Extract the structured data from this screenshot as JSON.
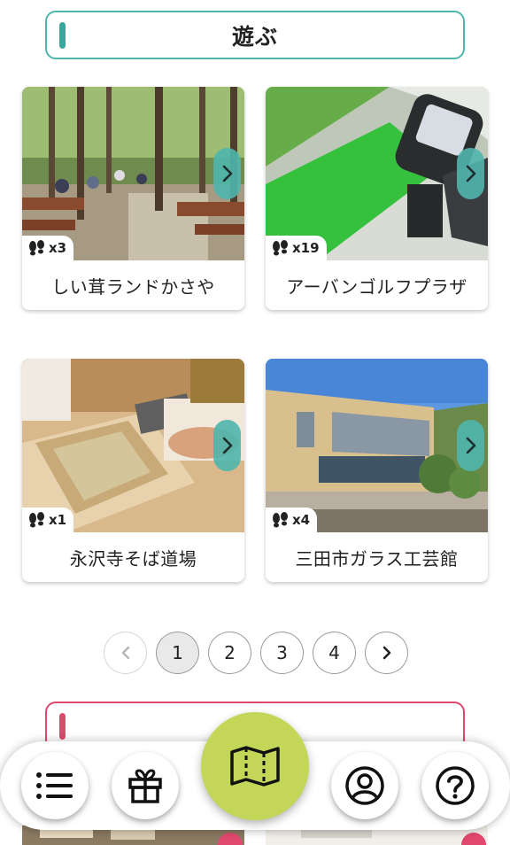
{
  "section": {
    "title": "遊ぶ"
  },
  "cards": [
    {
      "name": "しい茸ランドかさや",
      "visit_count": "x3"
    },
    {
      "name": "アーバンゴルフプラザ",
      "visit_count": "x19"
    },
    {
      "name": "永沢寺そば道場",
      "visit_count": "x1"
    },
    {
      "name": "三田市ガラス工芸館",
      "visit_count": "x4"
    }
  ],
  "pagination": {
    "prev_icon": "chevron-left-icon",
    "next_icon": "chevron-right-icon",
    "pages": [
      "1",
      "2",
      "3",
      "4"
    ],
    "current": "1"
  },
  "next_section": {
    "title": ""
  },
  "bottom_nav": [
    {
      "icon": "list-icon"
    },
    {
      "icon": "gift-icon"
    },
    {
      "icon": "map-icon"
    },
    {
      "icon": "user-icon"
    },
    {
      "icon": "help-icon"
    }
  ],
  "colors": {
    "accent_teal": "#4fb6ad",
    "accent_pink": "#e0486e",
    "map_green": "#c3d657"
  }
}
